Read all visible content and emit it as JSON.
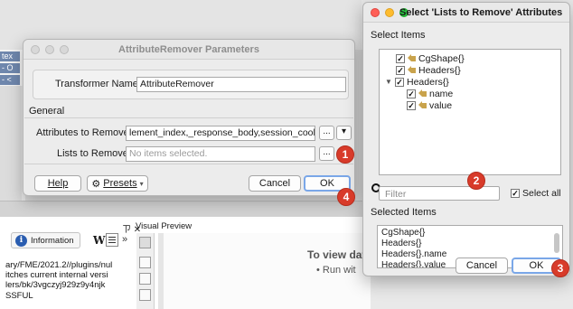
{
  "background": {
    "strip_chips": [
      "tex",
      "- O",
      "- <"
    ],
    "log_toolbar": {
      "info_label": "Information",
      "w_glyph": "W",
      "chevron": "»"
    },
    "log_lines": [
      "ary/FME/2021.2//plugins/nul",
      "itches current internal versi",
      "lers/bk/3vgczyj929z9y4njk",
      "SSFUL"
    ],
    "visual_preview": {
      "label": "Visual Preview",
      "close_glyph": "ㄗ ✕",
      "heading": "To view dat",
      "bullet": "• Run wit"
    }
  },
  "attr_remover": {
    "title": "AttributeRemover Parameters",
    "transformer_name_label": "Transformer Name:",
    "transformer_name_value": "AttributeRemover",
    "section_general": "General",
    "attrs_to_remove_label": "Attributes to Remove:",
    "attrs_to_remove_value": "lement_index,_response_body,session_cookie",
    "lists_to_remove_label": "Lists to Remove:",
    "lists_to_remove_placeholder": "No items selected.",
    "ellipsis": "...",
    "dropdown_glyph": "▾",
    "buttons": {
      "help": "Help",
      "presets": "Presets",
      "presets_caret": "▾",
      "cancel": "Cancel",
      "ok": "OK"
    }
  },
  "select_lists": {
    "title": "Select 'Lists to Remove' Attributes",
    "select_items_label": "Select Items",
    "tree": [
      {
        "label": "CgShape{}",
        "checked": true,
        "indent": 1,
        "icon": "attribute-icon"
      },
      {
        "label": "Headers{}",
        "checked": true,
        "indent": 1,
        "icon": "attribute-icon"
      },
      {
        "label": "Headers{}",
        "checked": true,
        "indent": 0,
        "icon": "none",
        "expanded": true
      },
      {
        "label": "name",
        "checked": true,
        "indent": 2,
        "icon": "attribute-icon"
      },
      {
        "label": "value",
        "checked": true,
        "indent": 2,
        "icon": "attribute-icon"
      }
    ],
    "filter_placeholder": "Filter",
    "select_all_label": "Select all",
    "select_all_checked": true,
    "selected_items_label": "Selected Items",
    "selected_items": [
      "CgShape{}",
      "Headers{}",
      "Headers{}.name",
      "Headers{}.value"
    ],
    "buttons": {
      "cancel": "Cancel",
      "ok": "OK"
    }
  },
  "badges": [
    "1",
    "2",
    "3",
    "4"
  ],
  "colors": {
    "badge_red": "#d83b2a",
    "attr_icon": "#c9a34c",
    "info_blue": "#2a5db0",
    "focus_ring": "#7aa7e8"
  }
}
